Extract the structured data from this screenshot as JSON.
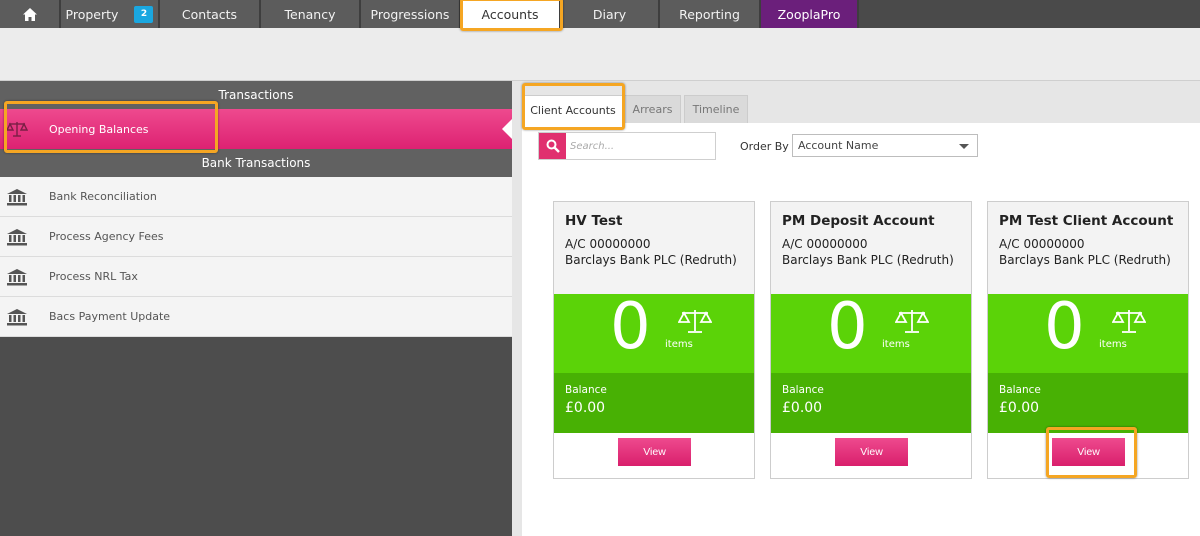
{
  "nav": {
    "items": [
      {
        "label": "Property",
        "badge": "2"
      },
      {
        "label": "Contacts"
      },
      {
        "label": "Tenancy"
      },
      {
        "label": "Progressions"
      },
      {
        "label": "Accounts"
      },
      {
        "label": "Diary"
      },
      {
        "label": "Reporting"
      },
      {
        "label": "ZooplaPro"
      }
    ],
    "active": "Accounts",
    "colors": {
      "bar": "#4a4a4a",
      "item": "#5c5c5c",
      "zoopla": "#6b1f7b",
      "badge": "#1aa7e0",
      "highlight": "#f5a623"
    }
  },
  "left": {
    "sections": [
      {
        "title": "Transactions",
        "items": [
          {
            "label": "Opening Balances",
            "icon": "scales-icon",
            "selected": true
          }
        ]
      },
      {
        "title": "Bank Transactions",
        "items": [
          {
            "label": "Bank Reconciliation",
            "icon": "bank-icon"
          },
          {
            "label": "Process Agency Fees",
            "icon": "bank-icon"
          },
          {
            "label": "Process NRL Tax",
            "icon": "bank-icon"
          },
          {
            "label": "Bacs Payment Update",
            "icon": "bank-icon"
          }
        ]
      }
    ],
    "colors": {
      "selected": "#e8347e"
    }
  },
  "tabs": [
    {
      "label": "Client Accounts",
      "active": true
    },
    {
      "label": "Arrears"
    },
    {
      "label": "Timeline"
    }
  ],
  "search": {
    "placeholder": "Search...",
    "icon": "search-icon"
  },
  "order_by": {
    "label": "Order By",
    "selected": "Account Name"
  },
  "cards": [
    {
      "name": "HV Test",
      "account": "A/C 00000000",
      "bank": "Barclays Bank PLC (Redruth)",
      "count": "0",
      "items_label": "items",
      "balance_label": "Balance",
      "balance": "£0.00",
      "view_label": "View"
    },
    {
      "name": "PM Deposit Account",
      "account": "A/C 00000000",
      "bank": "Barclays Bank PLC (Redruth)",
      "count": "0",
      "items_label": "items",
      "balance_label": "Balance",
      "balance": "£0.00",
      "view_label": "View"
    },
    {
      "name": "PM Test Client Account",
      "account": "A/C 00000000",
      "bank": "Barclays Bank PLC (Redruth)",
      "count": "0",
      "items_label": "items",
      "balance_label": "Balance",
      "balance": "£0.00",
      "view_label": "View"
    }
  ],
  "card_colors": {
    "green": "#5bd308",
    "dark_green": "#48b104",
    "button": "#e0306f"
  }
}
